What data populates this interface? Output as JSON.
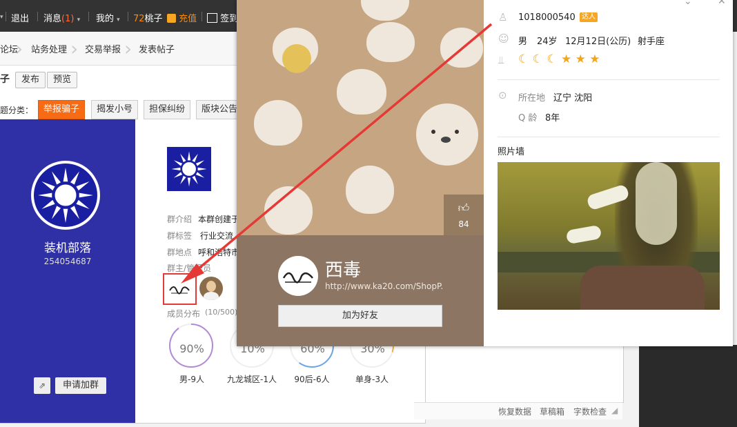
{
  "topbar": {
    "logout": "退出",
    "messages_label": "消息",
    "messages_count": "(1)",
    "mine": "我的",
    "peach_count": "72",
    "peach_label": "桃子",
    "recharge": "充值",
    "signin": "签到"
  },
  "breadcrumb": {
    "items": [
      "论坛",
      "站务处理",
      "交易举报",
      "发表帖子"
    ]
  },
  "postbar": {
    "title_frag": "子",
    "publish": "发布",
    "preview": "预览"
  },
  "category": {
    "label": "题分类：",
    "tabs": [
      "举报骗子",
      "揭发小号",
      "担保纠纷",
      "版块公告"
    ]
  },
  "group": {
    "name": "装机部落",
    "number": "254054687",
    "fields": [
      {
        "key": "群介绍",
        "value": "本群创建于"
      },
      {
        "key": "群标签",
        "value": "行业交流"
      },
      {
        "key": "群地点",
        "value": "呼和浩特市"
      },
      {
        "key": "群主/管理员",
        "value": ""
      }
    ],
    "member_dist_label": "成员分布",
    "member_count": "(10/500)",
    "stats": [
      {
        "value": "90%",
        "label": "男-9人"
      },
      {
        "value": "10%",
        "label": "九龙城区-1人"
      },
      {
        "value": "60%",
        "label": "90后-6人"
      },
      {
        "value": "30%",
        "label": "单身-3人"
      }
    ],
    "apply_label": "申请加群"
  },
  "editor": {
    "restore": "恢复数据",
    "draft": "草稿箱",
    "wordcheck": "字数检查"
  },
  "profile": {
    "nickname": "西毒",
    "url": "http://www.ka20.com/ShopP.",
    "likes": "84",
    "add_friend": "加为好友",
    "qq": "1018000540",
    "qq_badge": "达人",
    "gender": "男",
    "age": "24岁",
    "birthday": "12月12日(公历)",
    "zodiac": "射手座",
    "level_icons": [
      "moon-icon",
      "moon-icon",
      "moon-icon",
      "star-icon",
      "star-icon",
      "star-icon"
    ],
    "location_label": "所在地",
    "location": "辽宁 沈阳",
    "qage_label": "Q 龄",
    "qage": "8年",
    "photo_wall": "照片墙"
  },
  "colors": {
    "accent_orange": "#f76b15",
    "group_blue": "#2f2fa6",
    "annotation_red": "#e53935"
  }
}
